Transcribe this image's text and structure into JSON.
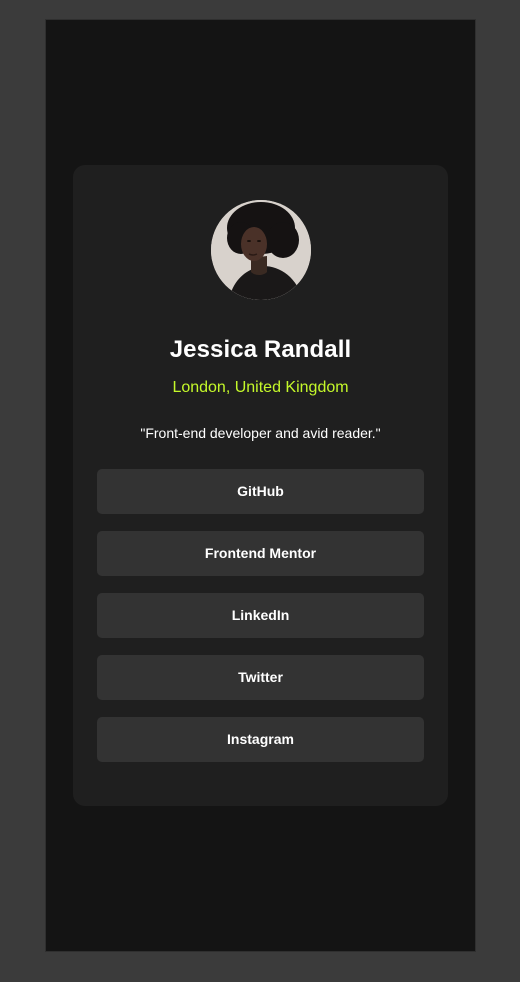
{
  "profile": {
    "name": "Jessica Randall",
    "location": "London, United Kingdom",
    "bio": "\"Front-end developer and avid reader.\"",
    "avatar_icon": "portrait-avatar"
  },
  "links": [
    {
      "label": "GitHub"
    },
    {
      "label": "Frontend Mentor"
    },
    {
      "label": "LinkedIn"
    },
    {
      "label": "Twitter"
    },
    {
      "label": "Instagram"
    }
  ],
  "colors": {
    "page_background": "#3b3b3b",
    "frame_background": "#141414",
    "card_background": "#1f1f1f",
    "button_background": "#333333",
    "accent": "#c4f82a",
    "text": "#ffffff"
  }
}
